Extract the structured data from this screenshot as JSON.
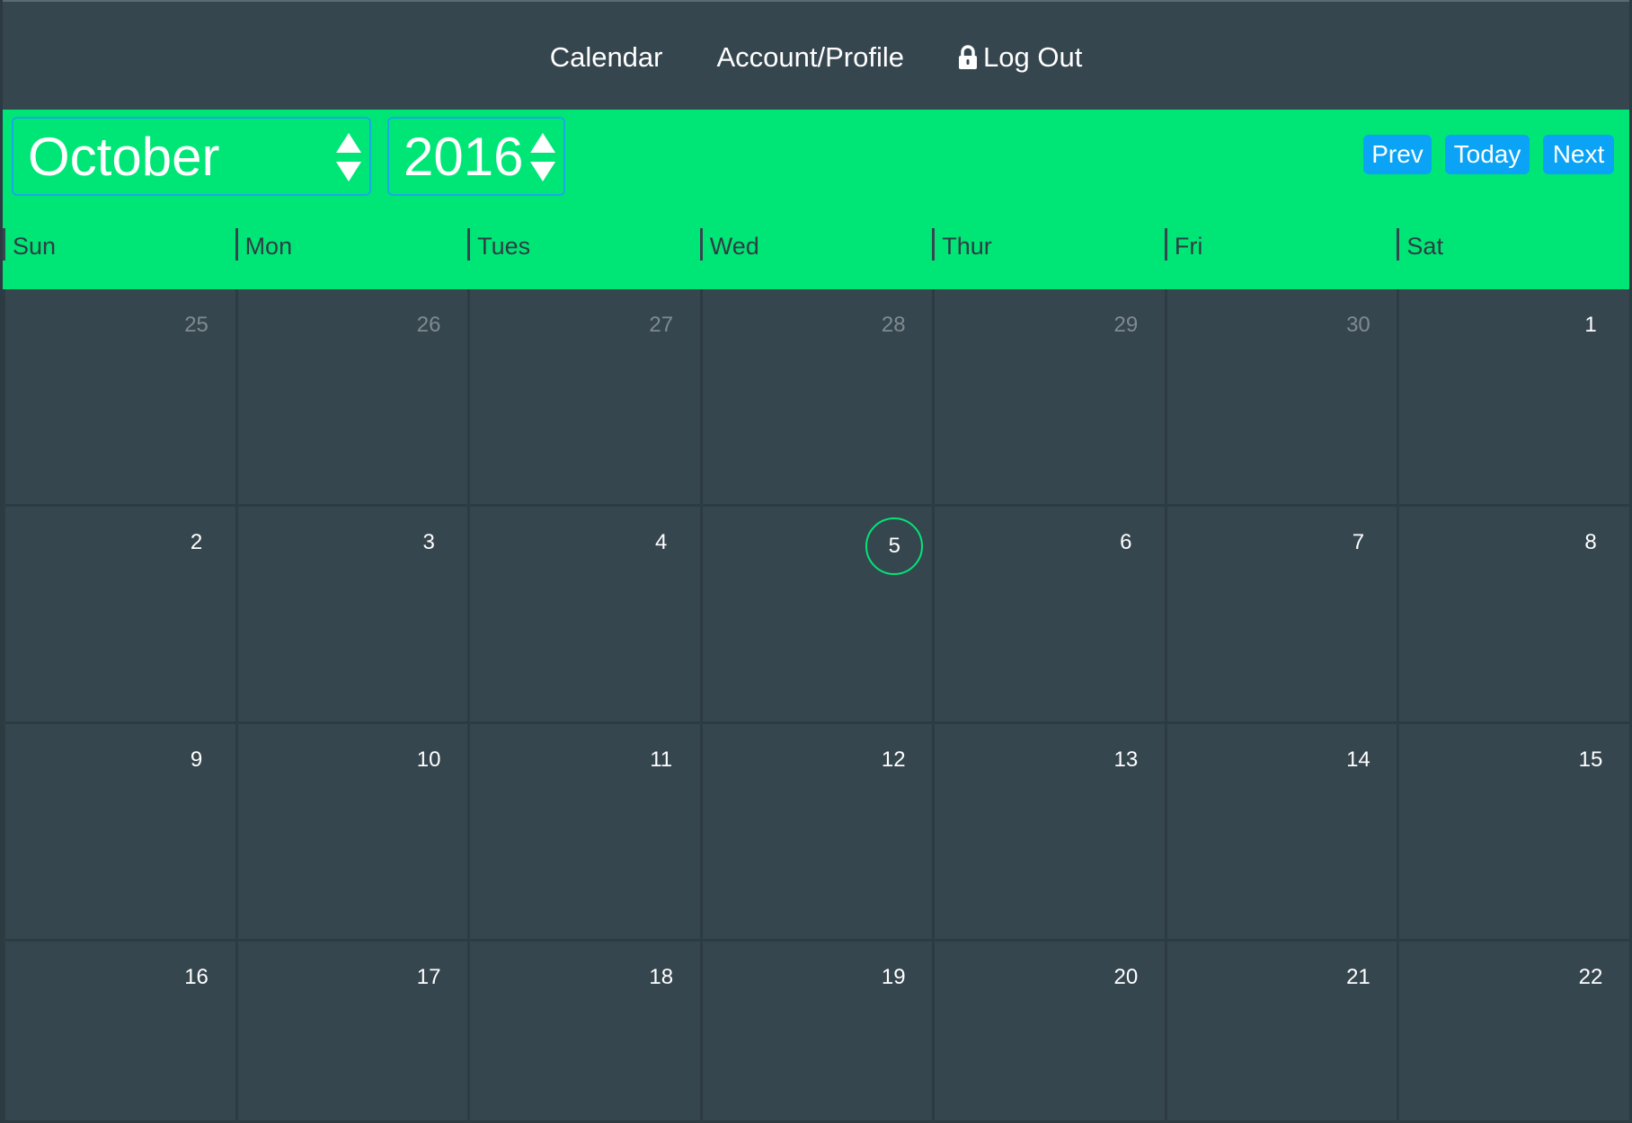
{
  "nav": {
    "calendar_label": "Calendar",
    "account_label": "Account/Profile",
    "logout_label": "Log Out",
    "logout_icon": "lock-icon"
  },
  "toolbar": {
    "month": "October",
    "year": "2016",
    "prev_label": "Prev",
    "today_label": "Today",
    "next_label": "Next",
    "accent_color": "#00e676",
    "button_color": "#0aa3f5"
  },
  "weekdays": [
    "Sun",
    "Mon",
    "Tues",
    "Wed",
    "Thur",
    "Fri",
    "Sat"
  ],
  "weeks": [
    [
      {
        "day": "25",
        "muted": true
      },
      {
        "day": "26",
        "muted": true
      },
      {
        "day": "27",
        "muted": true
      },
      {
        "day": "28",
        "muted": true
      },
      {
        "day": "29",
        "muted": true
      },
      {
        "day": "30",
        "muted": true
      },
      {
        "day": "1"
      }
    ],
    [
      {
        "day": "2"
      },
      {
        "day": "3"
      },
      {
        "day": "4"
      },
      {
        "day": "5",
        "today": true
      },
      {
        "day": "6"
      },
      {
        "day": "7"
      },
      {
        "day": "8"
      }
    ],
    [
      {
        "day": "9"
      },
      {
        "day": "10"
      },
      {
        "day": "11"
      },
      {
        "day": "12"
      },
      {
        "day": "13"
      },
      {
        "day": "14"
      },
      {
        "day": "15"
      }
    ],
    [
      {
        "day": "16"
      },
      {
        "day": "17"
      },
      {
        "day": "18"
      },
      {
        "day": "19"
      },
      {
        "day": "20"
      },
      {
        "day": "21"
      },
      {
        "day": "22"
      }
    ]
  ]
}
